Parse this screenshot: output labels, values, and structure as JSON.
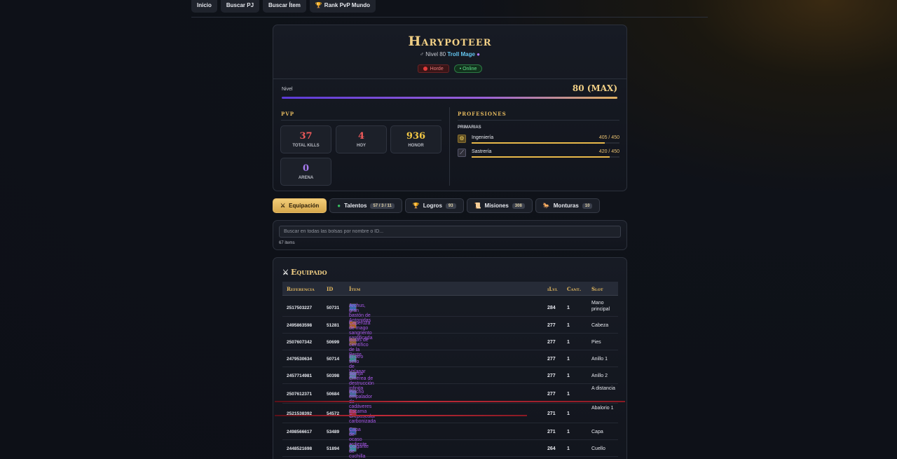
{
  "nav": [
    {
      "label": "Inicio",
      "icon": ""
    },
    {
      "label": "Buscar PJ",
      "icon": ""
    },
    {
      "label": "Buscar Ítem",
      "icon": ""
    },
    {
      "label": "Rank PvP Mundo",
      "icon": "trophy-icon"
    }
  ],
  "profile": {
    "name": "Harypoteer",
    "level_prefix": "♂ Nivel 80",
    "class_label": "Troll Mage",
    "faction": "Horde",
    "status": "• Online",
    "level_label": "Nivel",
    "level_value": "80 (MAX)",
    "level_fraction": 1.0
  },
  "pvp": {
    "title": "PVP",
    "stats": [
      {
        "value": "37",
        "label": "TOTAL KILLS",
        "color": "#ef5a5a"
      },
      {
        "value": "4",
        "label": "HOY",
        "color": "#ef5a5a"
      },
      {
        "value": "936",
        "label": "HONOR",
        "color": "#f2c744"
      },
      {
        "value": "0",
        "label": "ARENA",
        "color": "#a77bf0"
      }
    ]
  },
  "professions": {
    "title": "PROFESIONES",
    "primary_label": "PRIMARIAS",
    "items": [
      {
        "name": "Ingeniería",
        "value": "405 / 450",
        "fraction": 0.9,
        "icon": "gear-icon"
      },
      {
        "name": "Sastrería",
        "value": "420 / 450",
        "fraction": 0.933,
        "icon": "needle-icon"
      }
    ]
  },
  "tabs": [
    {
      "label": "Equipación",
      "count": "",
      "icon": "crossed-swords-icon",
      "active": true
    },
    {
      "label": "Talentos",
      "count": "57 / 3 / 11",
      "icon": "green-dot-icon",
      "active": false
    },
    {
      "label": "Logros",
      "count": "93",
      "icon": "trophy-icon",
      "active": false
    },
    {
      "label": "Misiones",
      "count": "308",
      "icon": "scroll-icon",
      "active": false
    },
    {
      "label": "Monturas",
      "count": "10",
      "icon": "horse-icon",
      "active": false
    }
  ],
  "search": {
    "placeholder": "Buscar en todas las bolsas por nombre o ID...",
    "count_text": "67 items"
  },
  "equipped": {
    "title": "Equipado",
    "columns": [
      "Referencia",
      "ID",
      "Ítem",
      "iLvl",
      "Cant.",
      "Slot"
    ],
    "rows": [
      {
        "ref": "2517503227",
        "id": "50731",
        "item": "Archus, gran bastón de Antonidas",
        "ilvl": "284",
        "qty": "1",
        "slot": "Mano principal",
        "icon_color": "#3a6aa8"
      },
      {
        "ref": "2495863598",
        "id": "51281",
        "item": "Caperuza de mago sangriento santificada",
        "ilvl": "277",
        "qty": "1",
        "slot": "Cabeza",
        "icon_color": "#a8602a"
      },
      {
        "ref": "2507607342",
        "id": "50699",
        "item": "Botas de científico de la Peste",
        "ilvl": "277",
        "qty": "1",
        "slot": "Pies",
        "icon_color": "#8a5a30"
      },
      {
        "ref": "2479530634",
        "id": "50714",
        "item": "El otro sello de Valanar",
        "ilvl": "277",
        "qty": "1",
        "slot": "Anillo 1",
        "icon_color": "#3a8a8a"
      },
      {
        "ref": "2457714981",
        "id": "50398",
        "item": "Sortija Cinérea de destrucción infinita",
        "ilvl": "277",
        "qty": "1",
        "slot": "Anillo 2",
        "icon_color": "#5a7aa0"
      },
      {
        "ref": "2507612371",
        "id": "50684",
        "item": "Pincho empalador de cadáveres",
        "ilvl": "277",
        "qty": "1",
        "slot": "A distancia",
        "icon_color": "#4a6a9a"
      },
      {
        "ref": "2521538392",
        "id": "54572",
        "item": "Escama Crepuscular carbonizada",
        "ilvl": "271",
        "qty": "1",
        "slot": "Abalorio 1",
        "icon_color": "#a03040"
      },
      {
        "ref": "2498566617",
        "id": "53489",
        "item": "Capa de ocaso ardiente",
        "ilvl": "271",
        "qty": "1",
        "slot": "Capa",
        "icon_color": "#3a5aa0"
      },
      {
        "ref": "2448521698",
        "id": "51894",
        "item": "Colgante de cuchilla de alma",
        "ilvl": "264",
        "qty": "1",
        "slot": "Cuello",
        "icon_color": "#3a8a9a"
      }
    ]
  }
}
